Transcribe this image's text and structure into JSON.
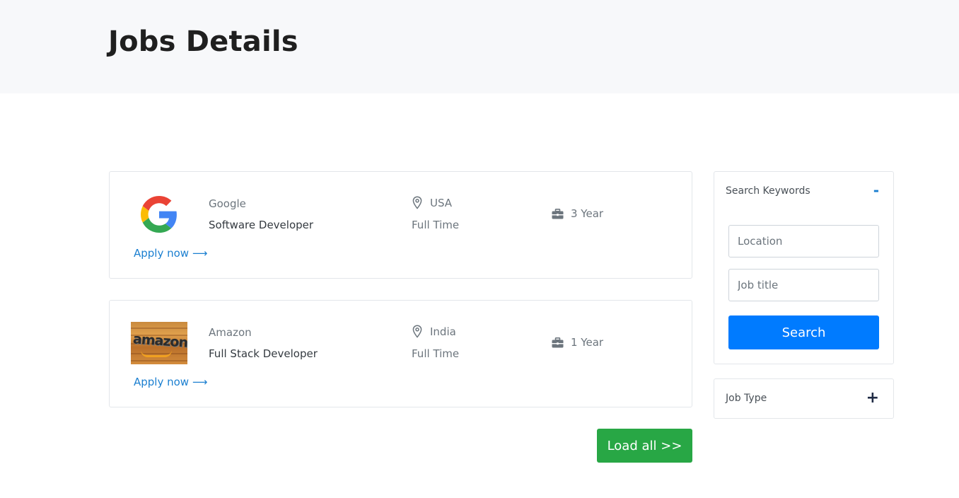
{
  "page": {
    "title": "Jobs Details"
  },
  "jobs": [
    {
      "company": "Google",
      "role": "Software Developer",
      "location": "USA",
      "type": "Full Time",
      "experience": "3 Year",
      "apply_label": "Apply now ⟶",
      "logo": "google-logo"
    },
    {
      "company": "Amazon",
      "role": "Full Stack Developer",
      "location": "India",
      "type": "Full Time",
      "experience": "1 Year",
      "apply_label": "Apply now ⟶",
      "logo": "amazon-logo",
      "logo_text": "amazon"
    }
  ],
  "load_all_label": "Load all >>",
  "sidebar": {
    "keywords": {
      "heading": "Search Keywords",
      "toggle": "-",
      "location_placeholder": "Location",
      "jobtitle_placeholder": "Job title",
      "search_label": "Search"
    },
    "job_type": {
      "heading": "Job Type",
      "toggle": "+"
    }
  },
  "colors": {
    "header_bg": "#f7f8fa",
    "link": "#1b7fd0",
    "primary": "#007bff",
    "success": "#28a745"
  }
}
